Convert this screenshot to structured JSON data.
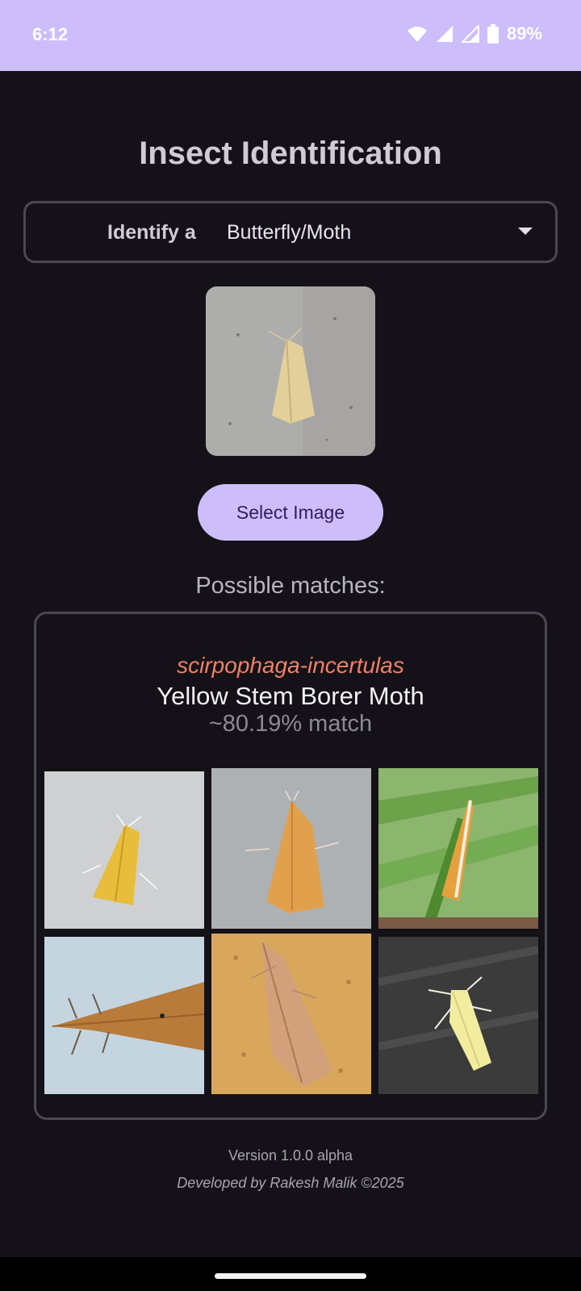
{
  "status_bar": {
    "time": "6:12",
    "battery": "89%",
    "icons": [
      "wifi-icon",
      "cell-signal-icon",
      "cell-signal-icon",
      "battery-icon"
    ]
  },
  "app": {
    "title": "Insect Identification",
    "dropdown": {
      "label": "Identify a",
      "selected": "Butterfly/Moth"
    },
    "select_button": "Select Image",
    "matches_heading": "Possible matches:"
  },
  "result": {
    "scientific_name": "scirpophaga-incertulas",
    "common_name": "Yellow Stem Borer Moth",
    "match": "~80.19% match"
  },
  "footer": {
    "version": "Version 1.0.0 alpha",
    "credit": "Developed by Rakesh Malik ©2025"
  },
  "colors": {
    "accent": "#cdbdfa",
    "background": "#141218",
    "scientific_name": "#f08066"
  }
}
